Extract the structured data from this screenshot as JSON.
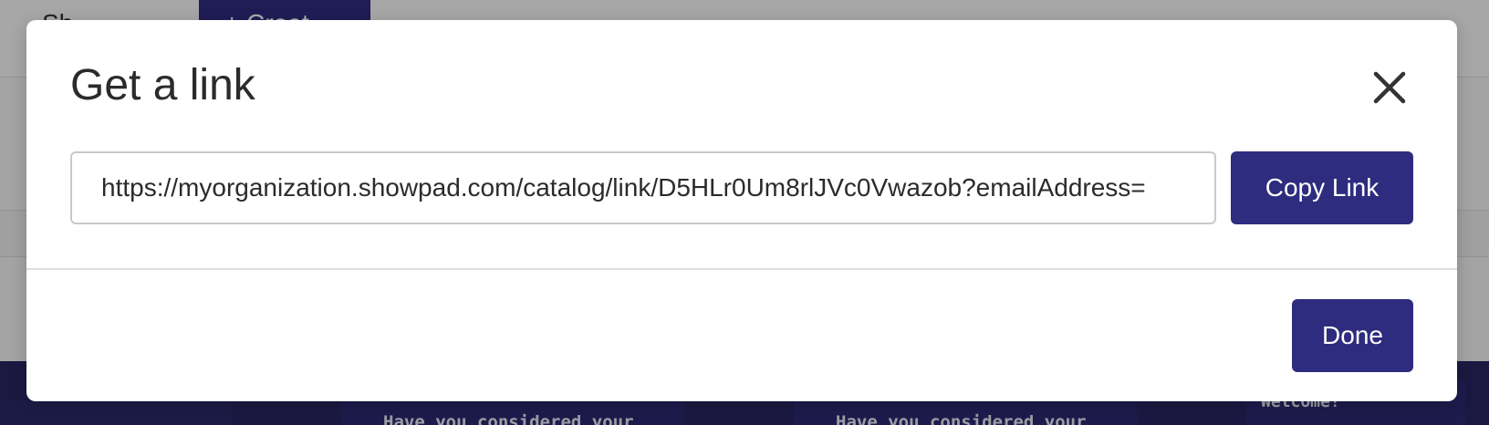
{
  "background": {
    "tab_left_label": "Sh",
    "tab_active_label": "+ Creat",
    "card_text_1": "Have you considered your",
    "card_text_2": "Have you considered your",
    "card_text_3": "Welcome!"
  },
  "modal": {
    "title": "Get a link",
    "close_icon": "close-icon",
    "link_value": "https://myorganization.showpad.com/catalog/link/D5HLr0Um8rlJVc0Vwazob?emailAddress=",
    "copy_label": "Copy Link",
    "done_label": "Done"
  },
  "colors": {
    "accent": "#2e2c7e",
    "overlay": "rgba(0,0,0,0.32)",
    "title_text": "#2b2b2b"
  }
}
